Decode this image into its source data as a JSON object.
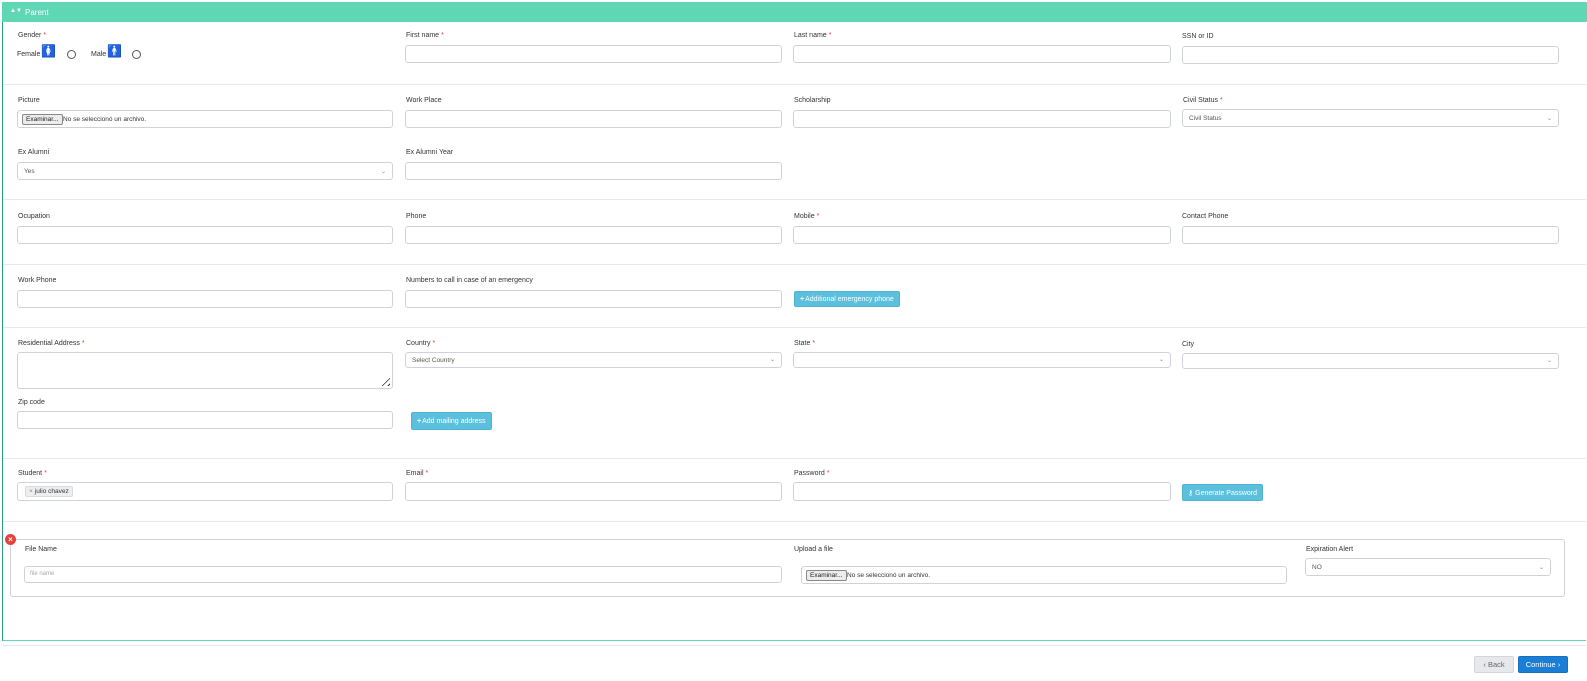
{
  "section": {
    "title": "Parent",
    "caret_icon": "caret-toggle-icon"
  },
  "gender": {
    "label": "Gender",
    "female_label": "Female",
    "male_label": "Male"
  },
  "fields": {
    "first_name": "First name",
    "last_name": "Last name",
    "ssn": "SSN or ID",
    "picture": "Picture",
    "work_place": "Work Place",
    "scholarship": "Scholarship",
    "civil_status": "Civil Status",
    "ex_alumni": "Ex Alumni",
    "ex_alumni_year": "Ex Alumni Year",
    "occupation": "Ocupation",
    "phone": "Phone",
    "mobile": "Mobile",
    "contact_phone": "Contact Phone",
    "work_phone": "Work Phone",
    "emergency_numbers": "Numbers to call in case of an emergency",
    "residential_address": "Residential Address",
    "country": "Country",
    "state": "State",
    "city": "City",
    "zip": "Zip code",
    "student": "Student",
    "email": "Email",
    "password": "Password"
  },
  "required_mark": "*",
  "file_input": {
    "button": "Examinar...",
    "status": "No se seleccionó un archivo."
  },
  "selects": {
    "civil_status_value": "Civil Status",
    "ex_alumni_value": "Yes",
    "country_value": "Select Country",
    "state_value": "",
    "city_value": "",
    "expiration_value": "NO"
  },
  "buttons": {
    "add_emergency_phone": "Additional emergency phone",
    "add_mailing_address": "Add mailing address",
    "generate_password": "Generate Password",
    "back": "‹ Back",
    "continue": "Continue ›"
  },
  "student_tag": {
    "remove": "×",
    "name": "julio chavez"
  },
  "file_panel": {
    "file_name_label": "File Name",
    "file_name_placeholder": "file name",
    "upload_label": "Upload a file",
    "expiration_label": "Expiration Alert"
  },
  "colors": {
    "header": "#5fd6b4",
    "info_button": "#5bc0de",
    "primary_button": "#1a7ed6",
    "required": "#e23b3b",
    "remove": "#e8413c"
  }
}
